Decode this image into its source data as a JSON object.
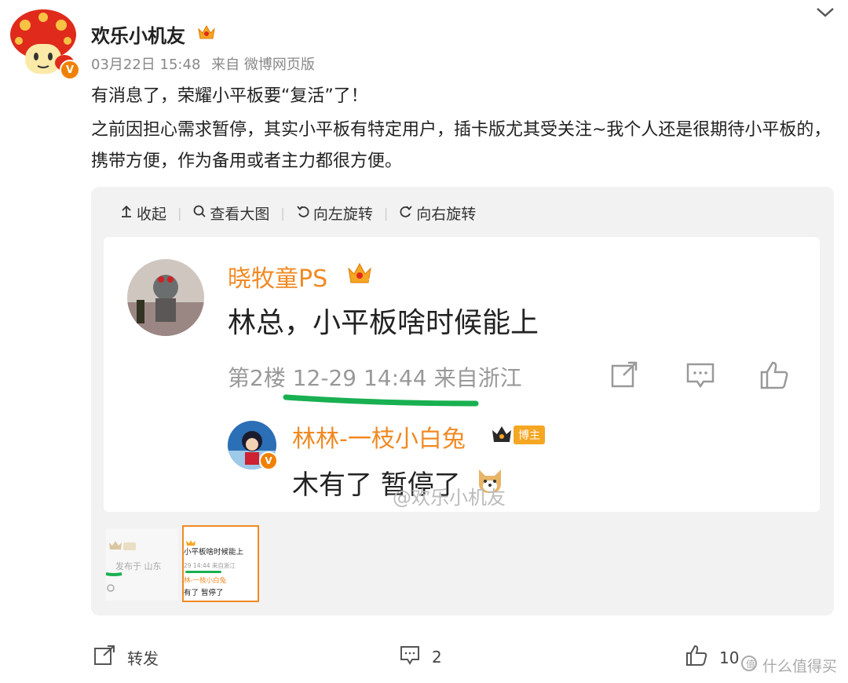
{
  "post": {
    "author": "欢乐小机友",
    "date": "03月22日 15:48",
    "source": "来自 微博网页版",
    "line1": "有消息了，荣耀小平板要“复活”了！",
    "line2": "之前因担心需求暂停，其实小平板有特定用户，插卡版尤其受关注~我个人还是很期待小平板的，携带方便，作为备用或者主力都很方便。"
  },
  "toolbar": {
    "collapse": "收起",
    "view_large": "查看大图",
    "rotate_left": "向左旋转",
    "rotate_right": "向右旋转"
  },
  "comment": {
    "user": "晓牧童PS",
    "content": "林总，小平板啥时候能上",
    "meta": "第2楼 12-29 14:44 来自浙江",
    "reply_user": "林林-一枝小白兔",
    "reply_badge": "博主",
    "reply_content": "木有了 暂停了",
    "image_watermark": "@欢乐小机友"
  },
  "thumbs": {
    "t1_text": "发布于 山东",
    "t2_line1": "小平板啥时候能上",
    "t2_line2": "29 14:44  来自浙江",
    "t2_line3": "林-一枝小白兔",
    "t2_line4": "有了 暂停了"
  },
  "footer": {
    "repost": "转发",
    "comment_count": "2",
    "like_count": "10",
    "site_watermark": "什么值得买"
  },
  "colors": {
    "orange": "#f08a24",
    "green": "#18b050",
    "badge": "#f08100"
  }
}
